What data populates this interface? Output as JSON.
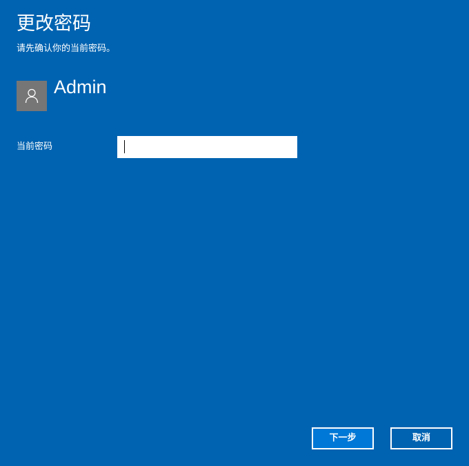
{
  "dialog": {
    "title": "更改密码",
    "subtitle": "请先确认你的当前密码。"
  },
  "account": {
    "username": "Admin",
    "avatar_icon": "user-avatar-icon"
  },
  "form": {
    "current_password_label": "当前密码",
    "current_password_value": "",
    "current_password_placeholder": ""
  },
  "buttons": {
    "next_label": "下一步",
    "cancel_label": "取消"
  },
  "colors": {
    "background": "#0063b1",
    "primary_button": "#0078d7",
    "avatar_background": "#767676",
    "text": "#ffffff"
  }
}
